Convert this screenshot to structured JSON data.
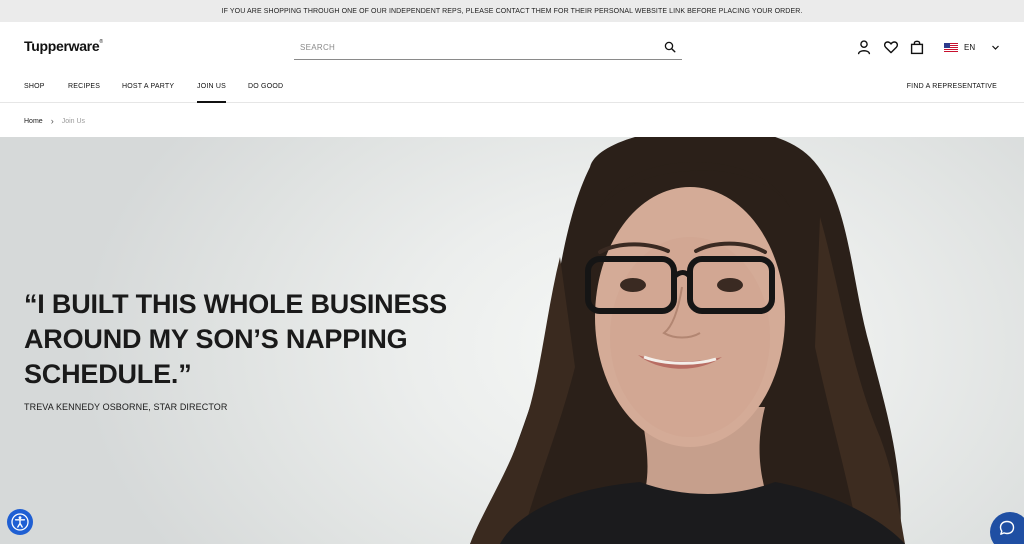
{
  "announcement": {
    "text": "IF YOU ARE SHOPPING THROUGH ONE OF OUR INDEPENDENT REPS, PLEASE CONTACT THEM FOR THEIR PERSONAL WEBSITE LINK BEFORE PLACING YOUR ORDER."
  },
  "header": {
    "logo": "Tupperware",
    "logo_mark": "®",
    "search": {
      "placeholder": "SEARCH",
      "value": ""
    },
    "icons": [
      "account-icon",
      "heart-icon",
      "bag-icon"
    ],
    "language": {
      "flag": "us-flag-icon",
      "label": "EN"
    }
  },
  "nav": {
    "items": [
      {
        "label": "SHOP"
      },
      {
        "label": "RECIPES"
      },
      {
        "label": "HOST A PARTY"
      },
      {
        "label": "JOIN US",
        "active": true
      },
      {
        "label": "DO GOOD"
      }
    ],
    "right_link": "FIND A REPRESENTATIVE"
  },
  "breadcrumb": {
    "home": "Home",
    "separator": "›",
    "current": "Join Us"
  },
  "hero": {
    "quote_line1": "“I BUILT THIS WHOLE BUSINESS",
    "quote_line2": "AROUND MY SON’S NAPPING",
    "quote_line3": "SCHEDULE.”",
    "attribution": "TREVA KENNEDY OSBORNE, STAR DIRECTOR"
  },
  "widgets": {
    "accessibility_icon": "accessibility-icon",
    "chat_icon": "chat-bubble-icon"
  },
  "colors": {
    "announcement_bg": "#ebebeb",
    "accent_blue": "#1f5fd3",
    "chat_blue": "#1f4fa3",
    "text": "#111111"
  }
}
